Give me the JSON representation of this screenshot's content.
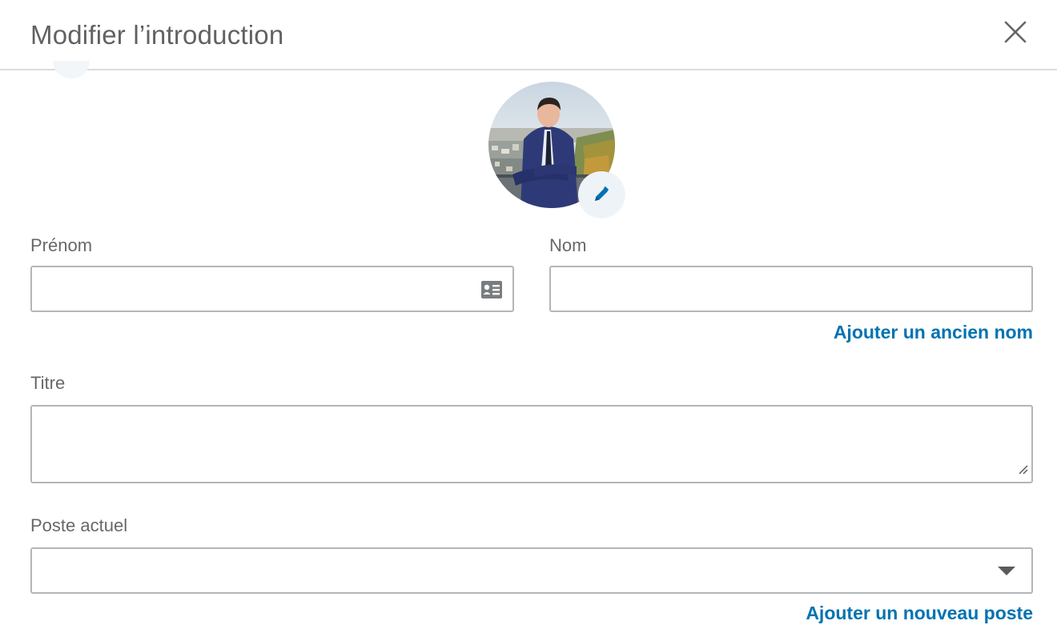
{
  "modal": {
    "title": "Modifier l’introduction"
  },
  "icons": {
    "close": "close-icon",
    "edit_photo": "pencil-icon",
    "autofill": "contact-card-icon",
    "dropdown": "caret-down-icon",
    "resize": "resize-grip-icon"
  },
  "colors": {
    "link": "#0073b1",
    "border": "#b3b6b9",
    "text": "#666666"
  },
  "form": {
    "first_name": {
      "label": "Prénom",
      "value": ""
    },
    "last_name": {
      "label": "Nom",
      "value": "",
      "link": "Ajouter un ancien nom"
    },
    "headline": {
      "label": "Titre",
      "value": ""
    },
    "current_position": {
      "label": "Poste actuel",
      "selected": "",
      "link": "Ajouter un nouveau poste"
    }
  }
}
